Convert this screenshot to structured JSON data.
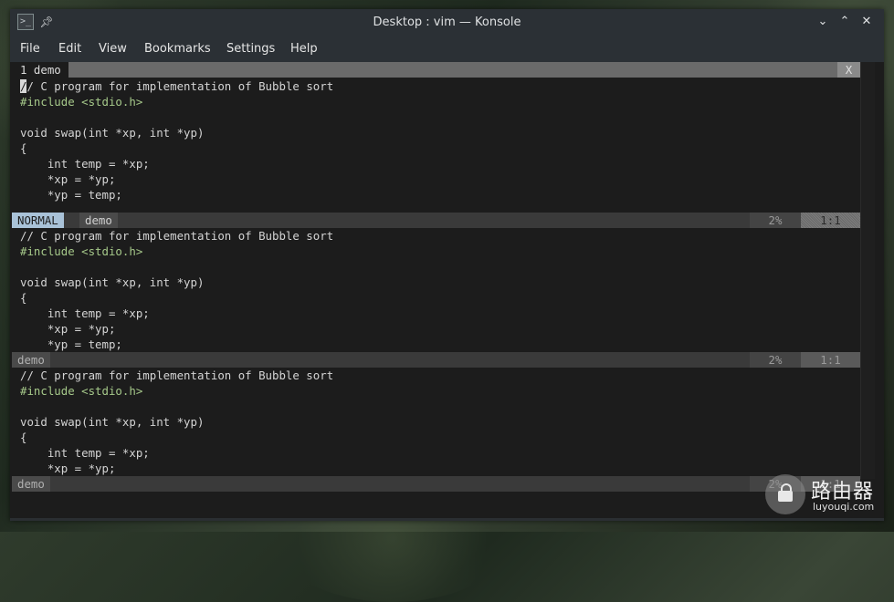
{
  "window": {
    "title": "Desktop : vim — Konsole"
  },
  "menubar": {
    "items": [
      "File",
      "Edit",
      "View",
      "Bookmarks",
      "Settings",
      "Help"
    ]
  },
  "vim": {
    "tabline": {
      "active_tab": "1 demo",
      "close_label": "X"
    },
    "splits": [
      {
        "lines": [
          "// C program for implementation of Bubble sort",
          "#include <stdio.h>",
          "",
          "void swap(int *xp, int *yp)",
          "{",
          "    int temp = *xp;",
          "    *xp = *yp;",
          "    *yp = temp;"
        ],
        "status": {
          "mode": "NORMAL",
          "filename": "demo",
          "percent": "2%",
          "position": "1:1",
          "active": true
        }
      },
      {
        "lines": [
          "// C program for implementation of Bubble sort",
          "#include <stdio.h>",
          "",
          "void swap(int *xp, int *yp)",
          "{",
          "    int temp = *xp;",
          "    *xp = *yp;",
          "    *yp = temp;"
        ],
        "status": {
          "mode": "",
          "filename": "demo",
          "percent": "2%",
          "position": "1:1",
          "active": false
        }
      },
      {
        "lines": [
          "// C program for implementation of Bubble sort",
          "#include <stdio.h>",
          "",
          "void swap(int *xp, int *yp)",
          "{",
          "    int temp = *xp;",
          "    *xp = *yp;"
        ],
        "status": {
          "mode": "",
          "filename": "demo",
          "percent": "2%",
          "position": "1:1",
          "active": false
        }
      }
    ]
  },
  "watermark": {
    "title": "路由器",
    "url": "luyouqi.com"
  }
}
